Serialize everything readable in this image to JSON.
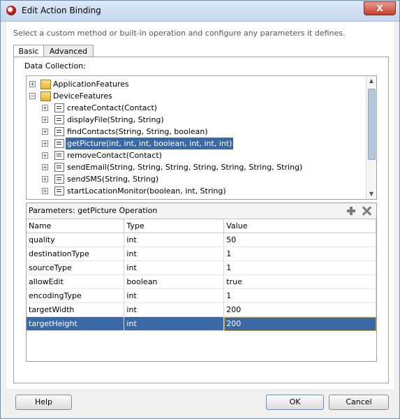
{
  "window": {
    "title": "Edit Action Binding",
    "close_label": "X"
  },
  "description": "Select a custom method or built-in operation and configure any parameters it defines.",
  "tabs": [
    {
      "label": "Basic"
    },
    {
      "label": "Advanced"
    }
  ],
  "data_collection_label": "Data Collection:",
  "tree": [
    {
      "label": "ApplicationFeatures",
      "expander": "+"
    },
    {
      "label": "DeviceFeatures",
      "expander": "−"
    },
    {
      "label": "createContact(Contact)",
      "expander": "+"
    },
    {
      "label": "displayFile(String, String)",
      "expander": "+"
    },
    {
      "label": "findContacts(String, String, boolean)",
      "expander": "+"
    },
    {
      "label": "getPicture(int, int, int, boolean, int, int, int)",
      "expander": "+"
    },
    {
      "label": "removeContact(Contact)",
      "expander": "+"
    },
    {
      "label": "sendEmail(String, String, String, String, String, String, String)",
      "expander": "+"
    },
    {
      "label": "sendSMS(String, String)",
      "expander": "+"
    },
    {
      "label": "startLocationMonitor(boolean, int, String)",
      "expander": "+"
    }
  ],
  "params": {
    "title": "Parameters:  getPicture Operation",
    "headers": [
      "Name",
      "Type",
      "Value"
    ],
    "rows": [
      [
        "quality",
        "int",
        "50"
      ],
      [
        "destinationType",
        "int",
        "1"
      ],
      [
        "sourceType",
        "int",
        "1"
      ],
      [
        "allowEdit",
        "boolean",
        "true"
      ],
      [
        "encodingType",
        "int",
        "1"
      ],
      [
        "targetWidth",
        "int",
        "200"
      ],
      [
        "targetHeight",
        "int",
        "200"
      ]
    ]
  },
  "buttons": {
    "help": "Help",
    "ok": "OK",
    "cancel": "Cancel"
  }
}
